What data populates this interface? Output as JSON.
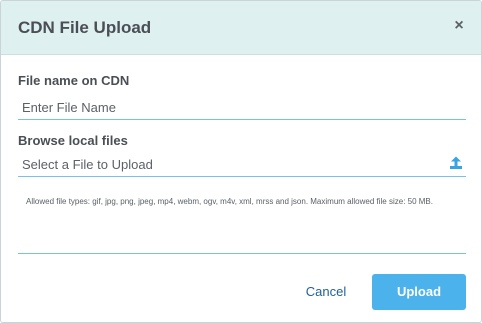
{
  "dialog": {
    "title": "CDN File Upload",
    "close_symbol": "×"
  },
  "file_name": {
    "label": "File name on CDN",
    "placeholder": "Enter File Name",
    "value": ""
  },
  "browse": {
    "label": "Browse local files",
    "placeholder": "Select a File to Upload",
    "value": "",
    "icon": "upload-icon",
    "icon_color": "#3aa3e3"
  },
  "help_text": "Allowed file types: gif, jpg, png, jpeg, mp4, webm, ogv, m4v, xml, mrss and json. Maximum allowed file size: 50 MB.",
  "actions": {
    "cancel_label": "Cancel",
    "upload_label": "Upload"
  },
  "colors": {
    "header_background": "#dff0f1",
    "accent": "#4bb2ec",
    "link": "#1f5f9a"
  }
}
